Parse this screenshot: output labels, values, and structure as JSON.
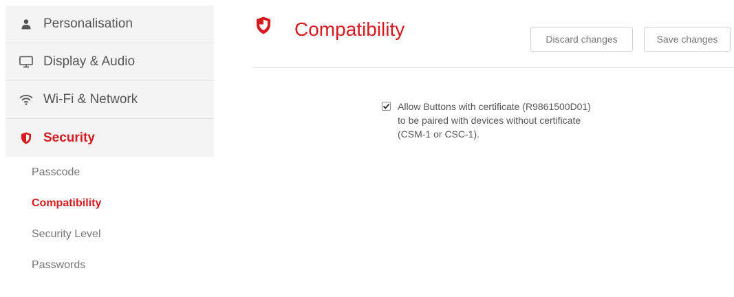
{
  "sidebar": {
    "items": [
      {
        "label": "Personalisation",
        "icon": "person-icon"
      },
      {
        "label": "Display & Audio",
        "icon": "monitor-icon"
      },
      {
        "label": "Wi-Fi & Network",
        "icon": "wifi-icon"
      },
      {
        "label": "Security",
        "icon": "shield-icon"
      }
    ],
    "subitems": [
      {
        "label": "Passcode"
      },
      {
        "label": "Compatibility"
      },
      {
        "label": "Security Level"
      },
      {
        "label": "Passwords"
      }
    ]
  },
  "header": {
    "title": "Compatibility",
    "discard_label": "Discard changes",
    "save_label": "Save changes"
  },
  "option": {
    "checked": true,
    "lines": [
      "Allow Buttons with certificate (R9861500D01)",
      "to be paired with devices without certificate",
      "(CSM-1 or CSC-1)."
    ]
  },
  "colors": {
    "accent": "#d71a1f",
    "sidebar_bg": "#f4f4f4",
    "text": "#555555"
  }
}
